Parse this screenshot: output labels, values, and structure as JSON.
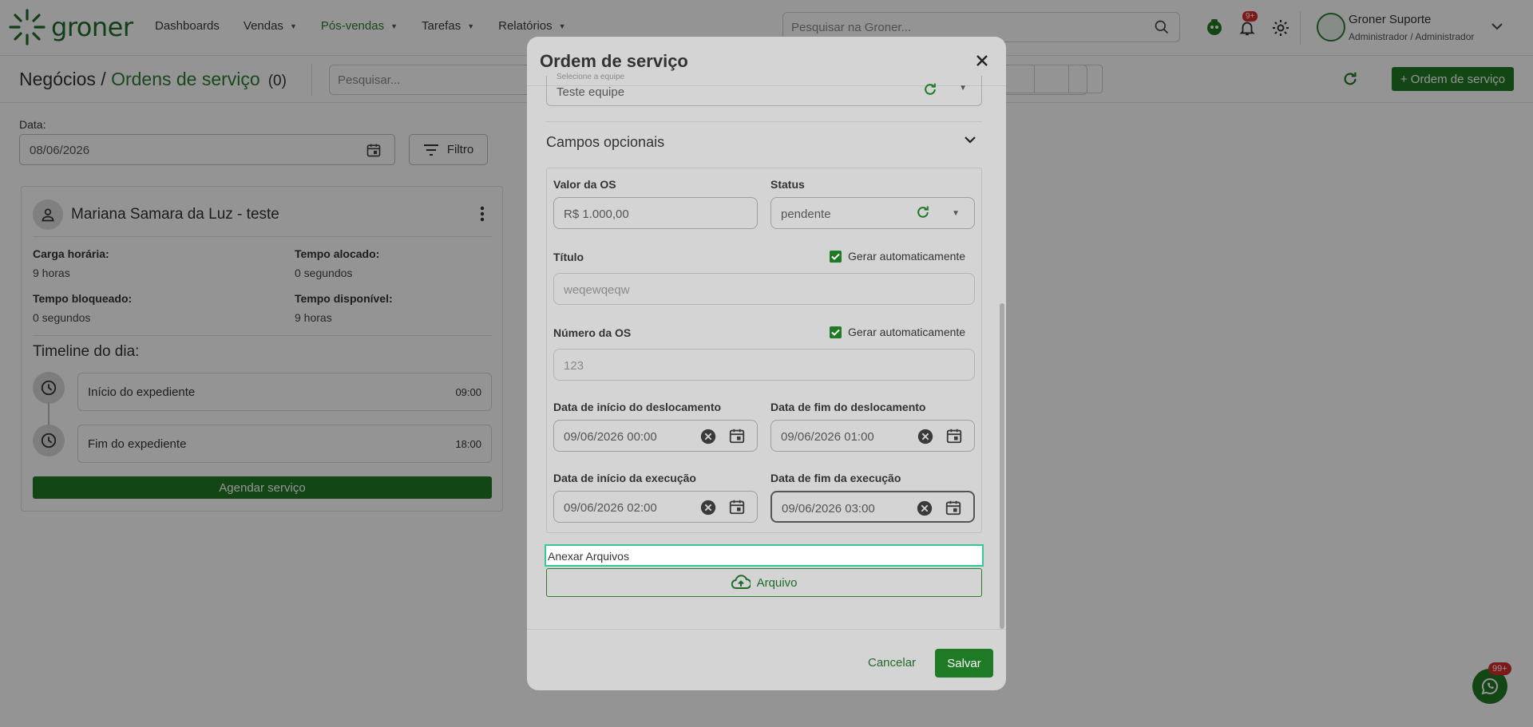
{
  "topbar": {
    "brand": "groner",
    "nav": [
      {
        "label": "Dashboards",
        "has_caret": false
      },
      {
        "label": "Vendas",
        "has_caret": true
      },
      {
        "label": "Pós-vendas",
        "has_caret": true
      },
      {
        "label": "Tarefas",
        "has_caret": true
      },
      {
        "label": "Relatórios",
        "has_caret": true
      }
    ],
    "search_placeholder": "Pesquisar na Groner...",
    "notification_badge": "9+",
    "user_name": "Groner Suporte",
    "user_role": "Administrador / Administrador"
  },
  "page": {
    "title_prefix": "Negócios / ",
    "title_section": "Ordens de serviço",
    "count": "(0)",
    "search_placeholder": "Pesquisar...",
    "new_button": "+ Ordem de serviço",
    "date_label": "Data:",
    "date_value": "08/06/2026",
    "filter_label": "Filtro"
  },
  "card": {
    "name": "Mariana Samara da Luz - teste",
    "stats": [
      {
        "key": "Carga horária:",
        "value": "9 horas"
      },
      {
        "key": "Tempo alocado:",
        "value": "0 segundos"
      },
      {
        "key": "Tempo bloqueado:",
        "value": "0 segundos"
      },
      {
        "key": "Tempo disponível:",
        "value": "9 horas"
      }
    ],
    "timeline_title": "Timeline do dia:",
    "timeline": [
      {
        "label": "Início do expediente",
        "time": "09:00"
      },
      {
        "label": "Fim do expediente",
        "time": "18:00"
      }
    ],
    "schedule_button": "Agendar serviço"
  },
  "whatsapp_badge": "99+",
  "modal": {
    "title": "Ordem de serviço",
    "team_label": "Selecione a equipe",
    "team_value": "Teste equipe",
    "optional_title": "Campos opcionais",
    "valor_label": "Valor da OS",
    "valor_value": "R$ 1.000,00",
    "status_label": "Status",
    "status_value": "pendente",
    "titulo_label": "Título",
    "auto_label": "Gerar automaticamente",
    "titulo_value": "weqewqeqw",
    "numero_label": "Número da OS",
    "numero_value": "123",
    "desl_inicio_label": "Data de início do deslocamento",
    "desl_inicio_value": "09/06/2026 00:00",
    "desl_fim_label": "Data de fim do deslocamento",
    "desl_fim_value": "09/06/2026 01:00",
    "exec_inicio_label": "Data de início da execução",
    "exec_inicio_value": "09/06/2026 02:00",
    "exec_fim_label": "Data de fim da execução",
    "exec_fim_value": "09/06/2026 03:00",
    "attach_label": "Anexar Arquivos",
    "file_button": "Arquivo",
    "cancel_label": "Cancelar",
    "save_label": "Salvar"
  },
  "colors": {
    "brand_green": "#1f7a25",
    "accent_focus": "#36c89a",
    "badge_red": "#d62d2d"
  }
}
